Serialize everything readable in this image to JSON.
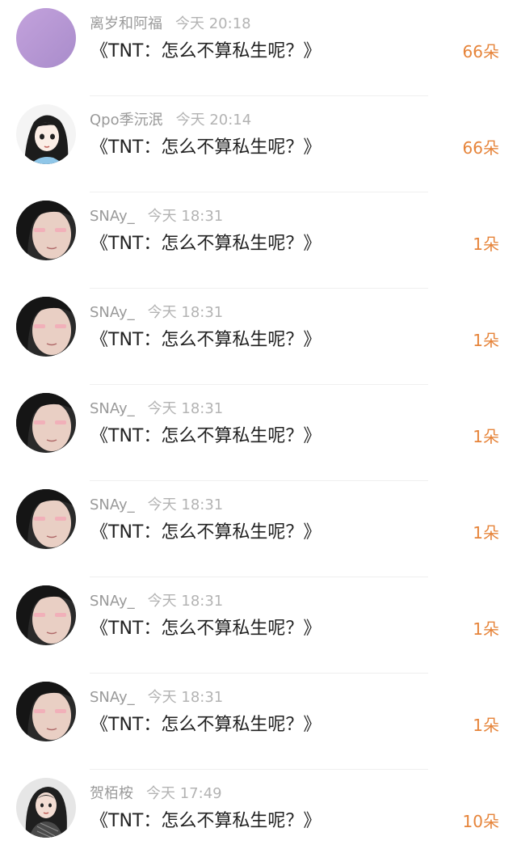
{
  "colors": {
    "name": "#9a9a9a",
    "message": "#222222",
    "count": "#e6843a",
    "divider": "#efefef"
  },
  "items": [
    {
      "name": "离岁和阿福",
      "time": "今天 20:18",
      "message": "《TNT：怎么不算私生呢？》",
      "count": "66朵",
      "avatar": "purple-circle-avatar"
    },
    {
      "name": "Qpo季沅泯",
      "time": "今天 20:14",
      "message": "《TNT：怎么不算私生呢？》",
      "count": "66朵",
      "avatar": "cartoon-girl-avatar"
    },
    {
      "name": "SNAy_",
      "time": "今天 18:31",
      "message": "《TNT：怎么不算私生呢？》",
      "count": "1朵",
      "avatar": "girl-photo-avatar"
    },
    {
      "name": "SNAy_",
      "time": "今天 18:31",
      "message": "《TNT：怎么不算私生呢？》",
      "count": "1朵",
      "avatar": "girl-photo-avatar"
    },
    {
      "name": "SNAy_",
      "time": "今天 18:31",
      "message": "《TNT：怎么不算私生呢？》",
      "count": "1朵",
      "avatar": "girl-photo-avatar"
    },
    {
      "name": "SNAy_",
      "time": "今天 18:31",
      "message": "《TNT：怎么不算私生呢？》",
      "count": "1朵",
      "avatar": "girl-photo-avatar"
    },
    {
      "name": "SNAy_",
      "time": "今天 18:31",
      "message": "《TNT：怎么不算私生呢？》",
      "count": "1朵",
      "avatar": "girl-photo-avatar"
    },
    {
      "name": "SNAy_",
      "time": "今天 18:31",
      "message": "《TNT：怎么不算私生呢？》",
      "count": "1朵",
      "avatar": "girl-photo-avatar"
    },
    {
      "name": "贺栢桉",
      "time": "今天 17:49",
      "message": "《TNT：怎么不算私生呢？》",
      "count": "10朵",
      "avatar": "woman-photo-avatar"
    }
  ]
}
